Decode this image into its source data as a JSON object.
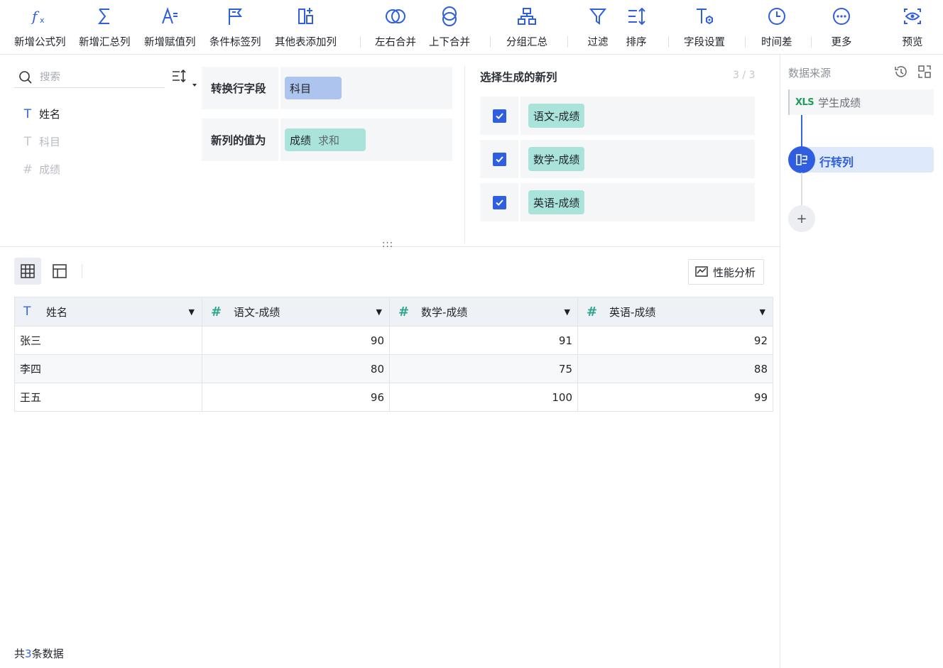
{
  "toolbar": {
    "formula": "新增公式列",
    "sum": "新增汇总列",
    "assign": "新增赋值列",
    "tag": "条件标签列",
    "other_table": "其他表添加列",
    "lr_merge": "左右合并",
    "ud_merge": "上下合并",
    "group": "分组汇总",
    "filter": "过滤",
    "sort": "排序",
    "field_setting": "字段设置",
    "time_diff": "时间差",
    "more": "更多",
    "preview": "预览"
  },
  "search": {
    "placeholder": "搜索"
  },
  "fields": [
    {
      "name": "姓名",
      "type": "text"
    },
    {
      "name": "科目",
      "type": "text"
    },
    {
      "name": "成绩",
      "type": "number"
    }
  ],
  "config": {
    "row_field_label": "转换行字段",
    "row_field_value": "科目",
    "value_label": "新列的值为",
    "value_field": "成绩",
    "value_agg": "求和"
  },
  "new_columns": {
    "title": "选择生成的新列",
    "count": "3 / 3",
    "items": [
      {
        "label": "语文-成绩",
        "checked": true
      },
      {
        "label": "数学-成绩",
        "checked": true
      },
      {
        "label": "英语-成绩",
        "checked": true
      }
    ]
  },
  "drag_handle": ":::",
  "perf_button": "性能分析",
  "table": {
    "headers": [
      "姓名",
      "语文-成绩",
      "数学-成绩",
      "英语-成绩"
    ],
    "rows": [
      [
        "张三",
        "90",
        "91",
        "92"
      ],
      [
        "李四",
        "80",
        "75",
        "88"
      ],
      [
        "王五",
        "96",
        "100",
        "99"
      ]
    ]
  },
  "footer": {
    "prefix": "共",
    "count": "3",
    "suffix": "条数据"
  },
  "right_panel": {
    "title": "数据来源",
    "source_icon": "XLS",
    "source": "学生成绩",
    "step": "行转列",
    "add": "+"
  },
  "colors": {
    "accent": "#2f5ee0",
    "teal_chip": "#a9e3d9",
    "blue_chip": "#adc4ee"
  }
}
